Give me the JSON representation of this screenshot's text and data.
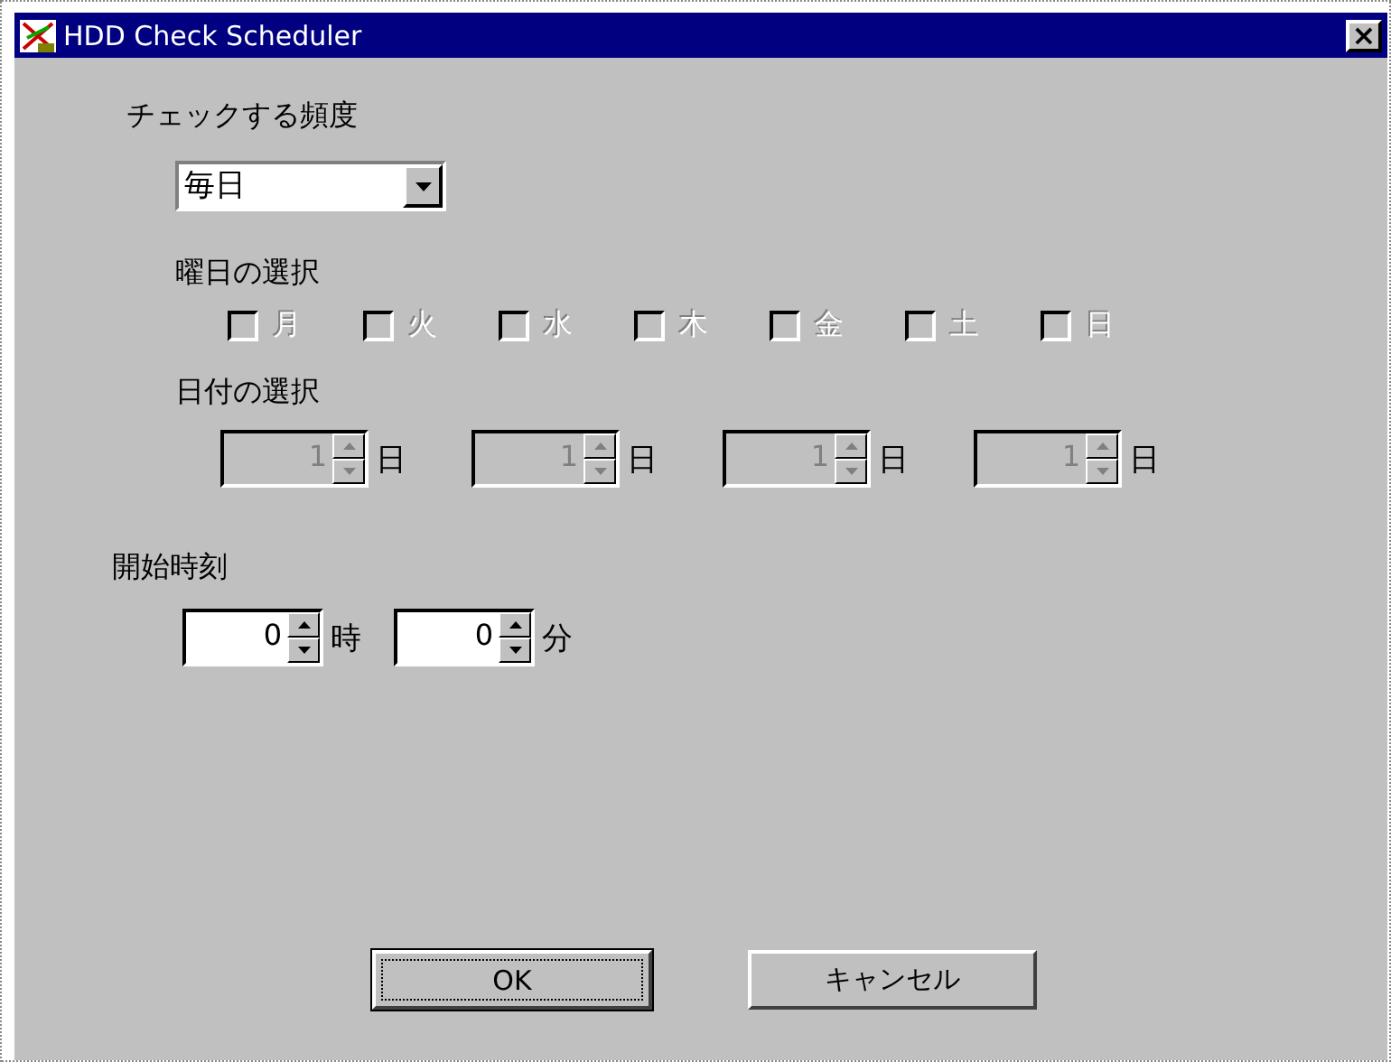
{
  "window": {
    "title": "HDD Check Scheduler",
    "close": "×"
  },
  "frequency": {
    "label": "チェックする頻度",
    "value": "毎日",
    "disabled": false
  },
  "weekdays": {
    "label": "曜日の選択",
    "items": [
      {
        "label": "月",
        "checked": false,
        "disabled": true
      },
      {
        "label": "火",
        "checked": false,
        "disabled": true
      },
      {
        "label": "水",
        "checked": false,
        "disabled": true
      },
      {
        "label": "木",
        "checked": false,
        "disabled": true
      },
      {
        "label": "金",
        "checked": false,
        "disabled": true
      },
      {
        "label": "土",
        "checked": false,
        "disabled": true
      },
      {
        "label": "日",
        "checked": false,
        "disabled": true
      }
    ]
  },
  "dates": {
    "label": "日付の選択",
    "items": [
      {
        "value": "1",
        "unit": "日",
        "disabled": true
      },
      {
        "value": "1",
        "unit": "日",
        "disabled": true
      },
      {
        "value": "1",
        "unit": "日",
        "disabled": true
      },
      {
        "value": "1",
        "unit": "日",
        "disabled": true
      }
    ]
  },
  "start_time": {
    "label": "開始時刻",
    "items": [
      {
        "value": "0",
        "unit": "時",
        "disabled": false
      },
      {
        "value": "0",
        "unit": "分",
        "disabled": false
      }
    ]
  },
  "buttons": [
    {
      "label": "OK",
      "default": true
    },
    {
      "label": "キャンセル",
      "default": false
    }
  ]
}
